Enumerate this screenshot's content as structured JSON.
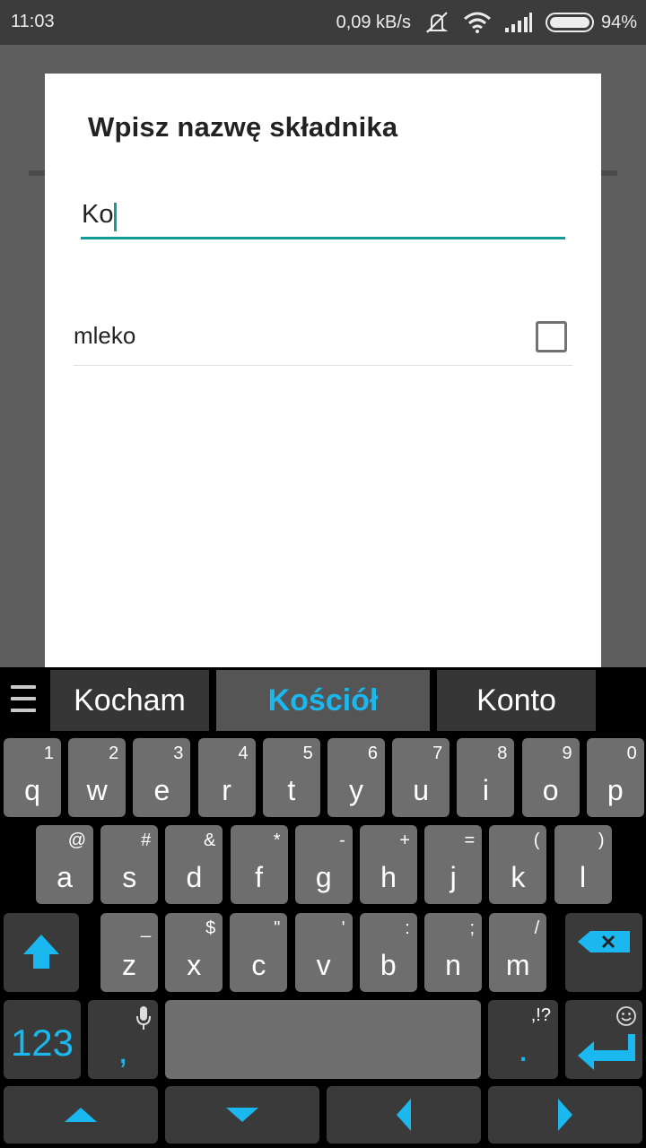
{
  "status": {
    "time": "11:03",
    "speed": "0,09 kB/s",
    "battery": "94%"
  },
  "dialog": {
    "title": "Wpisz nazwę składnika",
    "input_value": "Ko",
    "items": [
      {
        "label": "mleko",
        "checked": false
      }
    ]
  },
  "keyboard": {
    "suggestions": [
      "Kocham",
      "Kościół",
      "Konto"
    ],
    "row1": [
      {
        "k": "q",
        "s": "1"
      },
      {
        "k": "w",
        "s": "2"
      },
      {
        "k": "e",
        "s": "3"
      },
      {
        "k": "r",
        "s": "4"
      },
      {
        "k": "t",
        "s": "5"
      },
      {
        "k": "y",
        "s": "6"
      },
      {
        "k": "u",
        "s": "7"
      },
      {
        "k": "i",
        "s": "8"
      },
      {
        "k": "o",
        "s": "9"
      },
      {
        "k": "p",
        "s": "0"
      }
    ],
    "row2": [
      {
        "k": "a",
        "s": "@"
      },
      {
        "k": "s",
        "s": "#"
      },
      {
        "k": "d",
        "s": "&"
      },
      {
        "k": "f",
        "s": "*"
      },
      {
        "k": "g",
        "s": "-"
      },
      {
        "k": "h",
        "s": "+"
      },
      {
        "k": "j",
        "s": "="
      },
      {
        "k": "k",
        "s": "("
      },
      {
        "k": "l",
        "s": ")"
      }
    ],
    "row3": [
      {
        "k": "z",
        "s": "_"
      },
      {
        "k": "x",
        "s": "$"
      },
      {
        "k": "c",
        "s": "\""
      },
      {
        "k": "v",
        "s": "'"
      },
      {
        "k": "b",
        "s": ":"
      },
      {
        "k": "n",
        "s": ";"
      },
      {
        "k": "m",
        "s": "/"
      }
    ],
    "num_label": "123",
    "comma": ",",
    "period": ".",
    "period_sec": ",!?",
    "accent_color": "#1ab8ee"
  }
}
